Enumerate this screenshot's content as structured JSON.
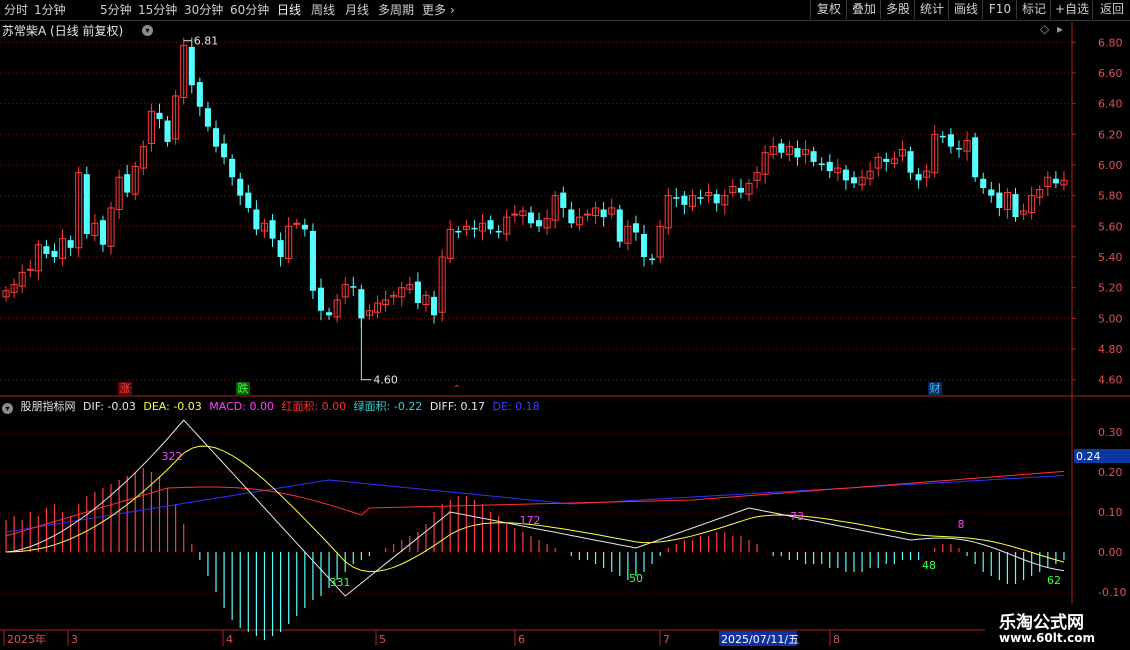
{
  "toolbar": {
    "periods": [
      "分时",
      "1分钟",
      "5分钟",
      "15分钟",
      "30分钟",
      "60分钟",
      "日线",
      "周线",
      "月线",
      "多周期",
      "更多"
    ],
    "active_period": "日线",
    "right_buttons": [
      "复权",
      "叠加",
      "多股",
      "统计",
      "画线",
      "F10",
      "标记",
      "+自选",
      "返回"
    ]
  },
  "stock": {
    "title": "苏常柴A (日线 前复权)"
  },
  "price_axis": {
    "ticks": [
      "6.80",
      "6.60",
      "6.40",
      "6.20",
      "6.00",
      "5.80",
      "5.60",
      "5.40",
      "5.20",
      "5.00",
      "4.80",
      "4.60"
    ],
    "range": [
      4.52,
      6.88
    ]
  },
  "price_labels": {
    "high": "6.81",
    "low": "4.60"
  },
  "event_tags": [
    {
      "text": "涨",
      "color": "#ff4040"
    },
    {
      "text": "跌",
      "color": "#40ff40"
    },
    {
      "text": "财",
      "color": "#40c0ff"
    }
  ],
  "indicator": {
    "name": "股朋指标网",
    "items": [
      {
        "label": "DIF: -0.03",
        "color": "#e8e8e8"
      },
      {
        "label": "DEA: -0.03",
        "color": "#ffff40"
      },
      {
        "label": "MACD: 0.00",
        "color": "#ff40ff"
      },
      {
        "label": "红面积: 0.00",
        "color": "#ff3030"
      },
      {
        "label": "绿面积: -0.22",
        "color": "#30d0d0"
      },
      {
        "label": "DIFF: 0.17",
        "color": "#e8e8e8"
      },
      {
        "label": "DE: 0.18",
        "color": "#4040ff"
      }
    ],
    "axis_ticks": [
      "0.30",
      "0.20",
      "0.10",
      "0.00",
      "-0.10"
    ],
    "current_value": "0.24",
    "area_labels": [
      {
        "text": "322",
        "color": "#ff40ff"
      },
      {
        "text": "331",
        "color": "#40ff40"
      },
      {
        "text": "172",
        "color": "#ff40ff"
      },
      {
        "text": "50",
        "color": "#40ff40"
      },
      {
        "text": "73",
        "color": "#ff40ff"
      },
      {
        "text": "48",
        "color": "#40ff40"
      },
      {
        "text": "8",
        "color": "#ff40ff"
      },
      {
        "text": "62",
        "color": "#40ff40"
      }
    ]
  },
  "date_axis": {
    "labels": [
      "2025年",
      "3",
      "4",
      "5",
      "6",
      "7",
      "8"
    ],
    "highlight": "2025/07/11/五"
  },
  "watermark": {
    "title": "乐淘公式网",
    "url": "www.60lt.com"
  },
  "colors": {
    "up": "#ff3b3b",
    "down": "#54ffff",
    "grid": "#7a1010",
    "axis": "#b02020"
  },
  "chart_data": {
    "type": "candlestick",
    "closes": [
      5.18,
      5.22,
      5.3,
      5.32,
      5.48,
      5.42,
      5.4,
      5.52,
      5.46,
      5.95,
      5.55,
      5.62,
      5.48,
      5.72,
      5.92,
      5.82,
      5.99,
      6.12,
      6.35,
      6.3,
      6.15,
      6.45,
      6.78,
      6.52,
      6.38,
      6.25,
      6.12,
      6.05,
      5.92,
      5.8,
      5.72,
      5.58,
      5.62,
      5.52,
      5.4,
      5.6,
      5.62,
      5.58,
      5.18,
      5.05,
      5.02,
      5.12,
      5.22,
      5.2,
      5.0,
      5.05,
      5.1,
      5.12,
      5.15,
      5.2,
      5.22,
      5.1,
      5.15,
      5.02,
      5.4,
      5.58,
      5.56,
      5.6,
      5.58,
      5.62,
      5.58,
      5.56,
      5.66,
      5.68,
      5.7,
      5.62,
      5.6,
      5.65,
      5.8,
      5.72,
      5.62,
      5.66,
      5.68,
      5.72,
      5.66,
      5.72,
      5.5,
      5.6,
      5.56,
      5.4,
      5.38,
      5.6,
      5.8,
      5.78,
      5.74,
      5.8,
      5.78,
      5.82,
      5.75,
      5.8,
      5.86,
      5.82,
      5.88,
      5.95,
      6.08,
      6.12,
      6.08,
      6.12,
      6.05,
      6.1,
      6.02,
      6.0,
      5.96,
      5.98,
      5.9,
      5.88,
      5.92,
      5.96,
      6.05,
      6.02,
      6.04,
      6.1,
      5.95,
      5.9,
      5.96,
      6.2,
      6.18,
      6.12,
      6.1,
      6.16,
      5.92,
      5.85,
      5.8,
      5.72,
      5.82,
      5.66,
      5.7,
      5.8,
      5.84,
      5.92,
      5.88,
      5.9
    ]
  }
}
